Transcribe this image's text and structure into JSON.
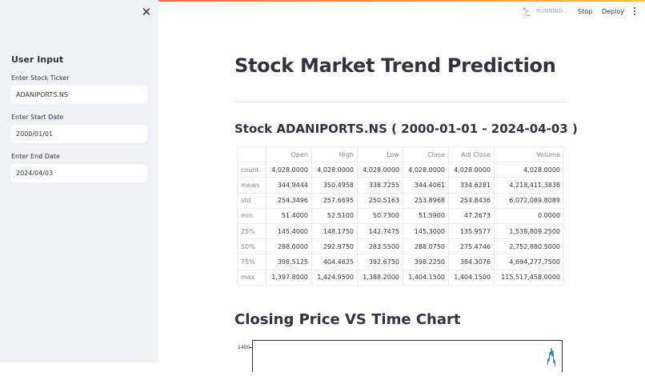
{
  "sidebar": {
    "title": "User Input",
    "fields": [
      {
        "label": "Enter Stock Ticker",
        "value": "ADANIPORTS.NS"
      },
      {
        "label": "Enter Start Date",
        "value": "2000/01/01"
      },
      {
        "label": "Enter End Date",
        "value": "2024/04/03"
      }
    ]
  },
  "toolbar": {
    "status": "RUNNING...",
    "stop_label": "Stop",
    "deploy_label": "Deploy"
  },
  "main": {
    "title": "Stock Market Trend Prediction",
    "subtitle": "Stock ADANIPORTS.NS ( 2000-01-01 - 2024-04-03 )",
    "table": {
      "columns": [
        "Open",
        "High",
        "Low",
        "Close",
        "Adj Close",
        "Volume"
      ],
      "rows": [
        {
          "index": "count",
          "values": [
            "4,028.0000",
            "4,028.0000",
            "4,028.0000",
            "4,028.0000",
            "4,028.0000",
            "4,028.0000"
          ]
        },
        {
          "index": "mean",
          "values": [
            "344.9444",
            "350.4958",
            "338.7255",
            "344.4061",
            "334.6281",
            "4,218,411.3838"
          ]
        },
        {
          "index": "std",
          "values": [
            "254.3496",
            "257.6695",
            "250.5163",
            "253.8968",
            "254.8436",
            "6,072,089.8089"
          ]
        },
        {
          "index": "min",
          "values": [
            "51.4000",
            "52.5100",
            "50.7300",
            "51.5900",
            "47.2673",
            "0.0000"
          ]
        },
        {
          "index": "25%",
          "values": [
            "145.4000",
            "148.1750",
            "142.7475",
            "145.3000",
            "135.9577",
            "1,538,809.2500"
          ]
        },
        {
          "index": "50%",
          "values": [
            "288.0000",
            "292.9750",
            "283.5500",
            "288.0750",
            "275.4746",
            "2,752,880.5000"
          ]
        },
        {
          "index": "75%",
          "values": [
            "398.5125",
            "404.4625",
            "392.6750",
            "398.2250",
            "384.3076",
            "4,694,277.7500"
          ]
        },
        {
          "index": "max",
          "values": [
            "1,397.8000",
            "1,424.9500",
            "1,388.2000",
            "1,404.1500",
            "1,404.1500",
            "115,517,458.0000"
          ]
        }
      ]
    },
    "chart_title": "Closing Price VS Time Chart",
    "chart_ytick": "1400"
  },
  "colors": {
    "sidebar_bg": "#f0f2f6",
    "accent_line": "#ff4b4b",
    "line_series": "#1f77b4"
  }
}
